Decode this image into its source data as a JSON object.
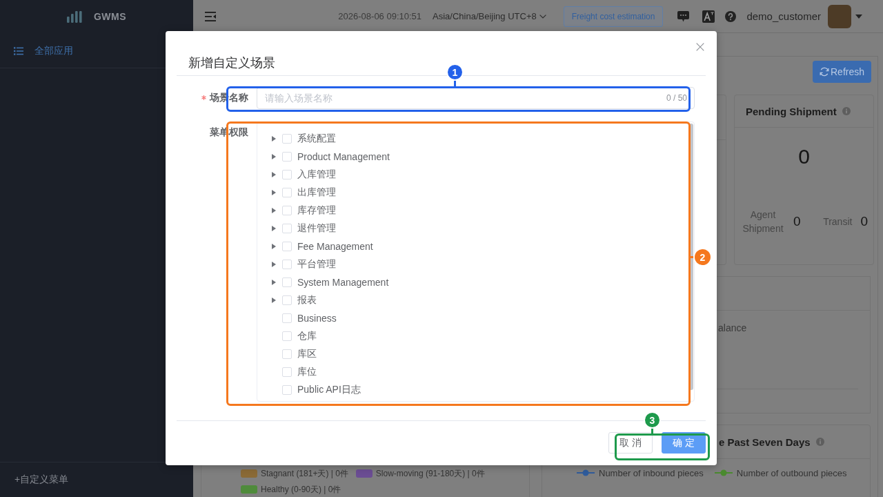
{
  "sidebar": {
    "logo": "GWMS",
    "menu": [
      {
        "label": "全部应用",
        "selected": true
      }
    ],
    "add_menu": "+自定义菜单"
  },
  "header": {
    "datetime": "2026-08-06 09:10:51",
    "timezone": "Asia/China/Beijing UTC+8",
    "freight_button": "Freight cost estimation",
    "username": "demo_customer"
  },
  "dashboard": {
    "refresh_button": "Refresh",
    "pending_card": {
      "title": "Pending Shipment",
      "total": "0",
      "stats": [
        {
          "label": "Agent Shipment",
          "value": "0"
        },
        {
          "label": "Transit",
          "value": "0"
        }
      ]
    },
    "balance_panel": {
      "text_fragment": "alance"
    },
    "inventory_legend": [
      {
        "label": "Stagnant (181+天) | 0件",
        "color": "#8a6a36"
      },
      {
        "label": "Slow-moving (91-180天) | 0件",
        "color": "#6b4d93"
      },
      {
        "label": "Healthy (0-90天) | 0件",
        "color": "#4f8b3b"
      }
    ],
    "trend_panel": {
      "title": "e Past Seven Days",
      "legend": [
        {
          "label": "Number of inbound pieces",
          "color": "#2f5c9c"
        },
        {
          "label": "Number of outbound pieces",
          "color": "#4a8a2f"
        }
      ]
    }
  },
  "dialog": {
    "title": "新增自定义场景",
    "name_field": {
      "label": "场景名称",
      "required": true,
      "placeholder": "请输入场景名称",
      "counter": "0 / 50",
      "callout": {
        "number": "1",
        "color": "#2361ea"
      }
    },
    "menu_field": {
      "label": "菜单权限",
      "callout": {
        "number": "2",
        "color": "#f5781e"
      },
      "tree": [
        {
          "label": "系统配置",
          "kind": "branch",
          "checked": false
        },
        {
          "label": "Product Management",
          "kind": "branch",
          "checked": false
        },
        {
          "label": "入库管理",
          "kind": "branch",
          "checked": false
        },
        {
          "label": "出库管理",
          "kind": "branch",
          "checked": false
        },
        {
          "label": "库存管理",
          "kind": "branch",
          "checked": false
        },
        {
          "label": "退件管理",
          "kind": "branch",
          "checked": false
        },
        {
          "label": "Fee Management",
          "kind": "branch",
          "checked": false
        },
        {
          "label": "平台管理",
          "kind": "branch",
          "checked": false
        },
        {
          "label": "System Management",
          "kind": "branch",
          "checked": false
        },
        {
          "label": "报表",
          "kind": "branch",
          "checked": false
        },
        {
          "label": "Business",
          "kind": "leaf",
          "checked": false
        },
        {
          "label": "仓库",
          "kind": "leaf",
          "checked": false
        },
        {
          "label": "库区",
          "kind": "leaf",
          "checked": false
        },
        {
          "label": "库位",
          "kind": "leaf",
          "checked": false
        },
        {
          "label": "Public API日志",
          "kind": "leaf",
          "checked": false
        }
      ]
    },
    "buttons": [
      {
        "label": "取 消",
        "kind": "default"
      },
      {
        "label": "确 定",
        "kind": "primary"
      }
    ],
    "buttons_callout": {
      "number": "3",
      "color": "#1e9a4c"
    }
  }
}
